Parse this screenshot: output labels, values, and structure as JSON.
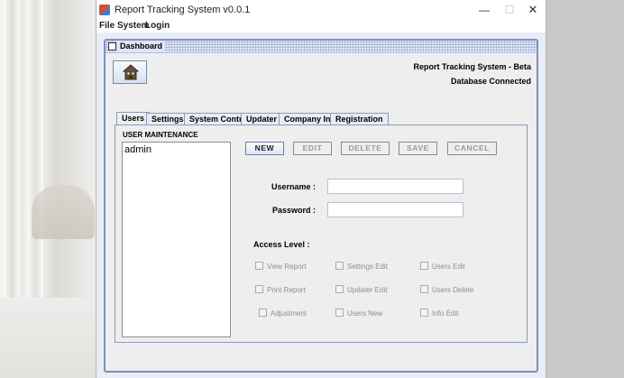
{
  "window": {
    "title": "Report Tracking System v0.0.1",
    "controls": {
      "minimize": "—",
      "maximize": "☐",
      "close": "✕"
    }
  },
  "menu": [
    "File",
    "System",
    "Login"
  ],
  "internal_frame": {
    "title": "Dashboard",
    "system_title": "Report Tracking System - Beta",
    "db_status": "Database Connected"
  },
  "tabs": [
    "Users",
    "Settings",
    "System Control",
    "Updater",
    "Company Info",
    "Registration"
  ],
  "active_tab": "Users",
  "user_maintenance": {
    "section_label": "USER MAINTENANCE",
    "users": [
      "admin"
    ],
    "buttons": [
      {
        "label": "NEW",
        "enabled": true
      },
      {
        "label": "EDIT",
        "enabled": false
      },
      {
        "label": "DELETE",
        "enabled": false
      },
      {
        "label": "SAVE",
        "enabled": false
      },
      {
        "label": "CANCEL",
        "enabled": false
      }
    ],
    "username_label": "Username :",
    "username_value": "",
    "password_label": "Password :",
    "password_value": "",
    "access_level_label": "Access Level :",
    "permissions": [
      {
        "label": "View Report",
        "checked": false,
        "enabled": false
      },
      {
        "label": "Settings Edit",
        "checked": false,
        "enabled": false
      },
      {
        "label": "Users Edit",
        "checked": false,
        "enabled": false
      },
      {
        "label": "Print Report",
        "checked": false,
        "enabled": false
      },
      {
        "label": "Updater Edit",
        "checked": false,
        "enabled": false
      },
      {
        "label": "Users Delete",
        "checked": false,
        "enabled": false
      },
      {
        "label": "Adjustment",
        "checked": false,
        "enabled": false
      },
      {
        "label": "Users New",
        "checked": false,
        "enabled": false
      },
      {
        "label": "Info Edit",
        "checked": false,
        "enabled": false
      }
    ]
  }
}
